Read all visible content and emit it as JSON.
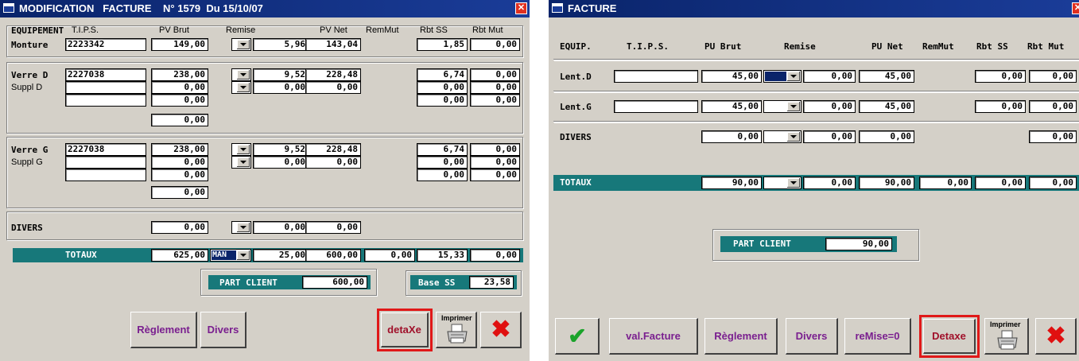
{
  "left": {
    "title": "MODIFICATION   FACTURE    N° 1579  Du 15/10/07",
    "headers": {
      "equip": "EQUIPEMENT",
      "tips": "T.I.P.S.",
      "pvbrut": "PV Brut",
      "remise": "Remise",
      "pvnet": "PV Net",
      "remmut": "RemMut",
      "rbtss": "Rbt SS",
      "rbtmut": "Rbt Mut"
    },
    "monture": {
      "label": "Monture",
      "code": "2223342",
      "pvbrut": "149,00",
      "remise": "5,96",
      "pvnet": "143,04",
      "rbtss": "1,85",
      "rbtmut": "0,00"
    },
    "verre_d": {
      "label": "Verre D",
      "code": "2227038",
      "pvbrut": "238,00",
      "remise": "9,52",
      "pvnet": "228,48",
      "rbtss": "6,74",
      "rbtmut": "0,00",
      "suppl_label": "Suppl D",
      "suppl1": {
        "pvbrut": "0,00",
        "remise": "0,00",
        "pvnet": "0,00",
        "rbtss": "0,00",
        "rbtmut": "0,00"
      },
      "suppl2": {
        "pvbrut": "0,00",
        "rbtss": "0,00",
        "rbtmut": "0,00"
      },
      "extra": "0,00"
    },
    "verre_g": {
      "label": "Verre G",
      "code": "2227038",
      "pvbrut": "238,00",
      "remise": "9,52",
      "pvnet": "228,48",
      "rbtss": "6,74",
      "rbtmut": "0,00",
      "suppl_label": "Suppl G",
      "suppl1": {
        "pvbrut": "0,00",
        "remise": "0,00",
        "pvnet": "0,00",
        "rbtss": "0,00",
        "rbtmut": "0,00"
      },
      "suppl2": {
        "pvbrut": "0,00",
        "rbtss": "0,00",
        "rbtmut": "0,00"
      },
      "extra": "0,00"
    },
    "divers": {
      "label": "DIVERS",
      "pvbrut": "0,00",
      "remise": "0,00",
      "pvnet": "0,00"
    },
    "totaux": {
      "label": "TOTAUX",
      "pvbrut": "625,00",
      "mode": "MAN",
      "remise": "25,00",
      "pvnet": "600,00",
      "remmut": "0,00",
      "rbtss": "15,33",
      "rbtmut": "0,00"
    },
    "part_client": {
      "label": "PART CLIENT",
      "value": "600,00"
    },
    "base_ss": {
      "label": "Base SS",
      "value": "23,58"
    },
    "buttons": {
      "reglement": "Règlement",
      "divers": "Divers",
      "detaxe": "detaXe",
      "imprimer": "Imprimer"
    }
  },
  "right": {
    "title": "FACTURE",
    "headers": {
      "equip": "EQUIP.",
      "tips": "T.I.P.S.",
      "pubrut": "PU Brut",
      "remise": "Remise",
      "punet": "PU Net",
      "remmut": "RemMut",
      "rbtss": "Rbt SS",
      "rbtmut": "Rbt Mut"
    },
    "lent_d": {
      "label": "Lent.D",
      "pubrut": "45,00",
      "remise": "0,00",
      "punet": "45,00",
      "rbtss": "0,00",
      "rbtmut": "0,00"
    },
    "lent_g": {
      "label": "Lent.G",
      "pubrut": "45,00",
      "remise": "0,00",
      "punet": "45,00",
      "rbtss": "0,00",
      "rbtmut": "0,00"
    },
    "divers": {
      "label": "DIVERS",
      "pubrut": "0,00",
      "remise": "0,00",
      "punet": "0,00",
      "rbtmut": "0,00"
    },
    "totaux": {
      "label": "TOTAUX",
      "pubrut": "90,00",
      "remise": "0,00",
      "punet": "90,00",
      "remmut": "0,00",
      "rbtss": "0,00",
      "rbtmut": "0,00"
    },
    "part_client": {
      "label": "PART CLIENT",
      "value": "90,00"
    },
    "buttons": {
      "valfacture": "val.Facture",
      "reglement": "Règlement",
      "divers": "Divers",
      "remise0": "reMise=0",
      "detaxe": "Detaxe",
      "imprimer": "Imprimer"
    }
  },
  "colors": {
    "window_bg": "#d4d0c8",
    "title_bg": "#0a246a",
    "teal": "#17787a",
    "highlight": "#e01818",
    "button_purple": "#7a1f8f"
  }
}
